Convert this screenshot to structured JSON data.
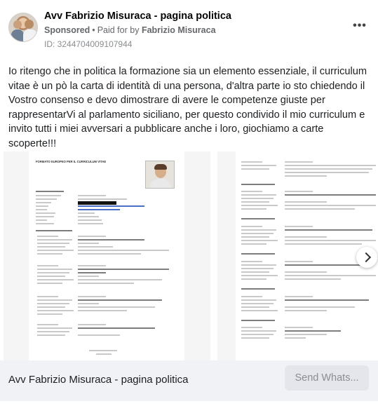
{
  "post": {
    "page_name": "Avv Fabrizio Misuraca - pagina politica",
    "sponsored_label": "Sponsored",
    "separator": "•",
    "paid_for_prefix": "Paid for by",
    "payer": "Fabrizio Misuraca",
    "ad_id": "ID: 3244704009107944",
    "more_icon": "more-horizontal-icon",
    "body_text": "Io ritengo che in politica la formazione sia un elemento essenziale, il curriculum vitae è un pò la carta di identità di una persona, d'altra parte io sto chiedendo il Vostro consenso e devo dimostrare di avere le competenze giuste per rappresentarVi al parlamento siciliano, per questo condivido il mio curriculum e invito tutti i miei avversari a pubblicare anche i loro, giochiamo a carte scoperte!!!",
    "emoji": "grinning-face-emoji"
  },
  "carousel": {
    "slide1_heading": "FORMATO EUROPEO PER IL CURRICULUM VITAE",
    "next_icon": "chevron-right-icon"
  },
  "footer": {
    "title": "Avv Fabrizio Misuraca - pagina politica",
    "cta_label": "Send Whats..."
  },
  "colors": {
    "meta_gray": "#65676b",
    "footer_bg": "#f0f2f5",
    "cta_bg": "#e4e6eb"
  }
}
